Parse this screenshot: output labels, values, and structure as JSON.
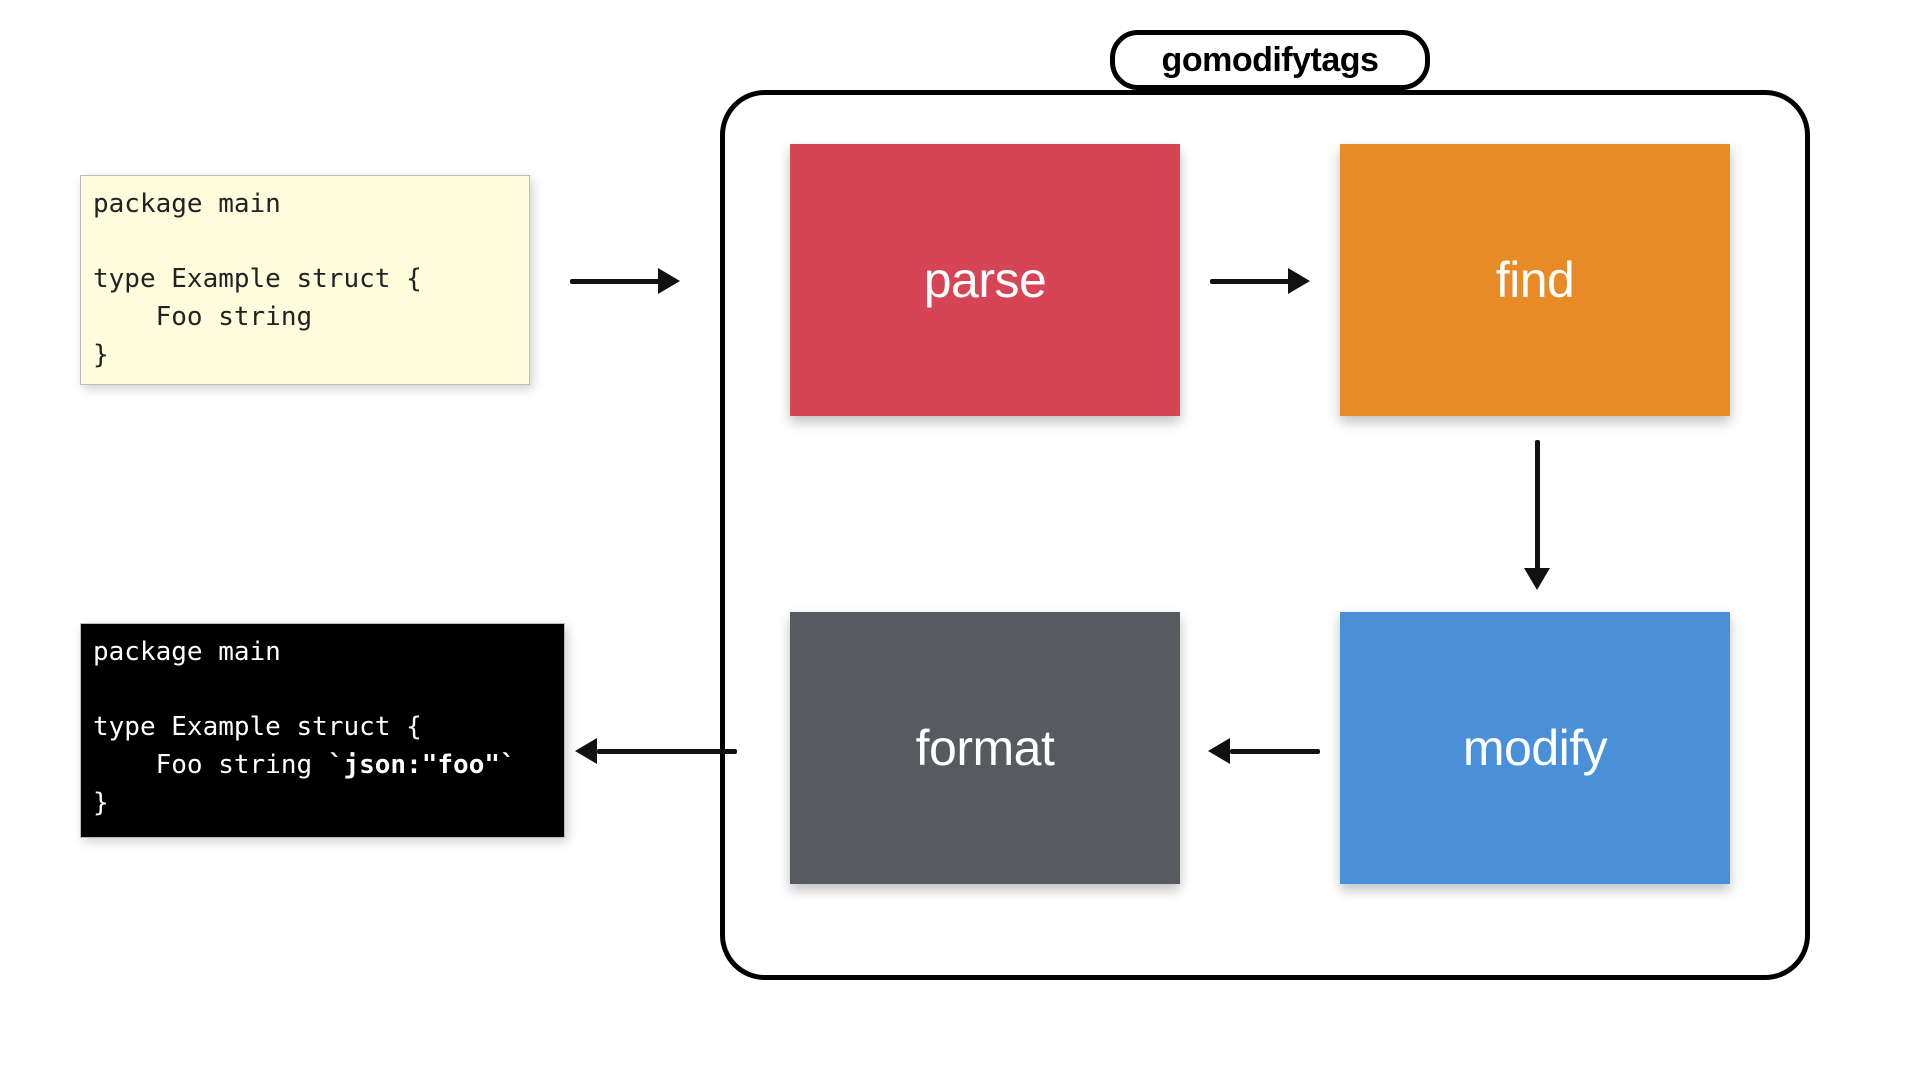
{
  "title": "gomodifytags",
  "input_code": "package main\n\ntype Example struct {\n    Foo string\n}",
  "output_code_pre": "package main\n\ntype Example struct {\n    Foo string ",
  "output_code_tag": "`json:\"foo\"`",
  "output_code_post": "\n}",
  "stages": {
    "parse": "parse",
    "find": "find",
    "modify": "modify",
    "format": "format"
  },
  "colors": {
    "parse": "#d64556",
    "find": "#e88a26",
    "modify": "#4a90d9",
    "format": "#575a5e",
    "input_bg": "#fdfcdc",
    "output_bg": "#000000"
  }
}
